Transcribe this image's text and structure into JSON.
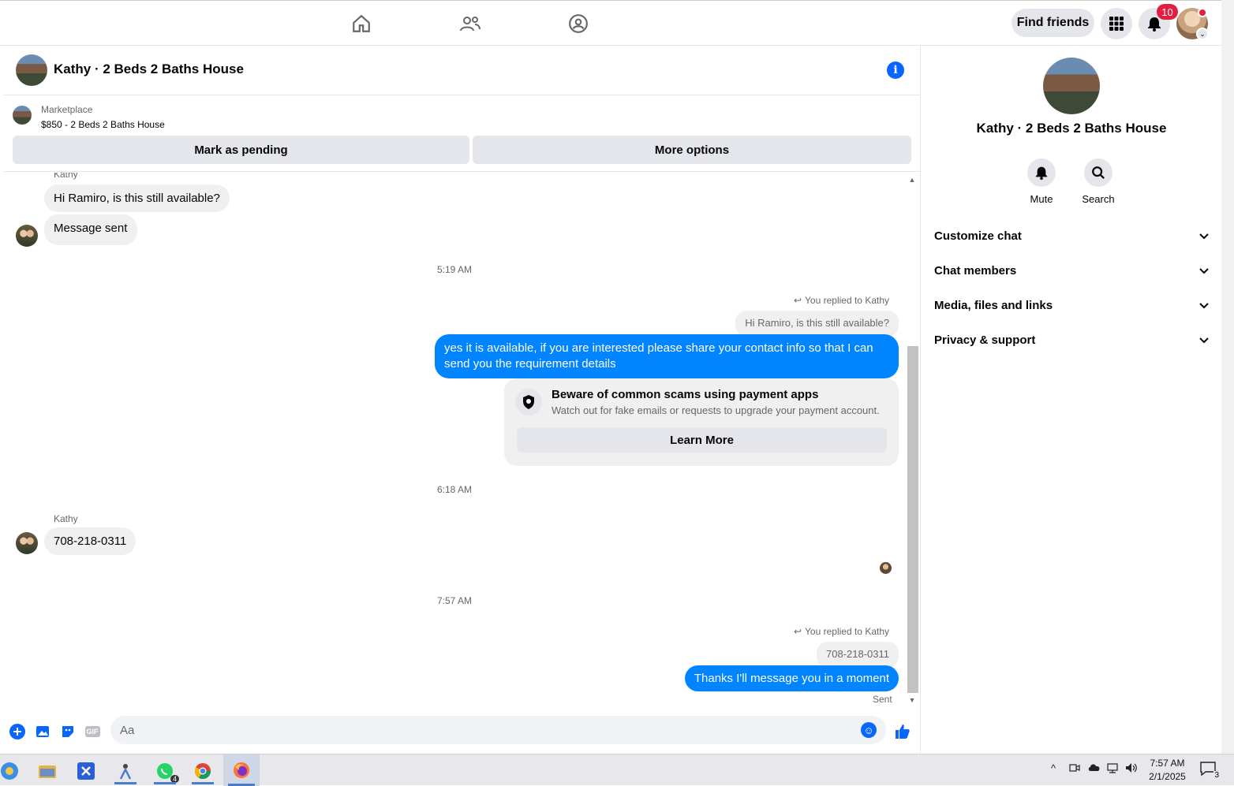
{
  "topbar": {
    "find_friends": "Find friends",
    "notification_count": "10",
    "icons": [
      "home-icon",
      "friends-icon",
      "groups-icon",
      "menu-grid-icon",
      "bell-icon"
    ]
  },
  "chat": {
    "title": "Kathy · 2 Beds 2 Baths House",
    "marketplace_label": "Marketplace",
    "listing": "$850 - 2 Beds 2 Baths House",
    "mark_pending": "Mark as pending",
    "more_options": "More options",
    "messages": {
      "sender1": "Kathy",
      "in1": "Hi Ramiro, is this still available?",
      "in2": "Message sent",
      "time1": "5:19 AM",
      "replied1": "You replied to Kathy",
      "quote1": "Hi Ramiro, is this still available?",
      "out1_line1": "yes it is available, if you are interested please share your contact info so that I can",
      "out1_line2": "send you the requirement details",
      "warn_title": "Beware of common scams using payment apps",
      "warn_sub": "Watch out for fake emails or requests to upgrade your payment account.",
      "learn_more": "Learn More",
      "time2": "6:18 AM",
      "sender2": "Kathy",
      "in3": "708-218-0311",
      "time3": "7:57 AM",
      "replied2": "You replied to Kathy",
      "quote2": "708-218-0311",
      "out2": "Thanks I'll message you in a moment",
      "status": "Sent"
    },
    "composer": {
      "placeholder": "Aa",
      "gif": "GIF"
    }
  },
  "panel": {
    "title": "Kathy · 2 Beds 2 Baths House",
    "mute": "Mute",
    "search": "Search",
    "sections": [
      "Customize chat",
      "Chat members",
      "Media, files and links",
      "Privacy & support"
    ]
  },
  "taskbar": {
    "whatsapp_badge": "4",
    "time": "7:57 AM",
    "date": "2/1/2025",
    "notifications": "3"
  },
  "colors": {
    "accent": "#0084ff",
    "brand_blue": "#0866ff",
    "badge_red": "#e41e3f"
  }
}
